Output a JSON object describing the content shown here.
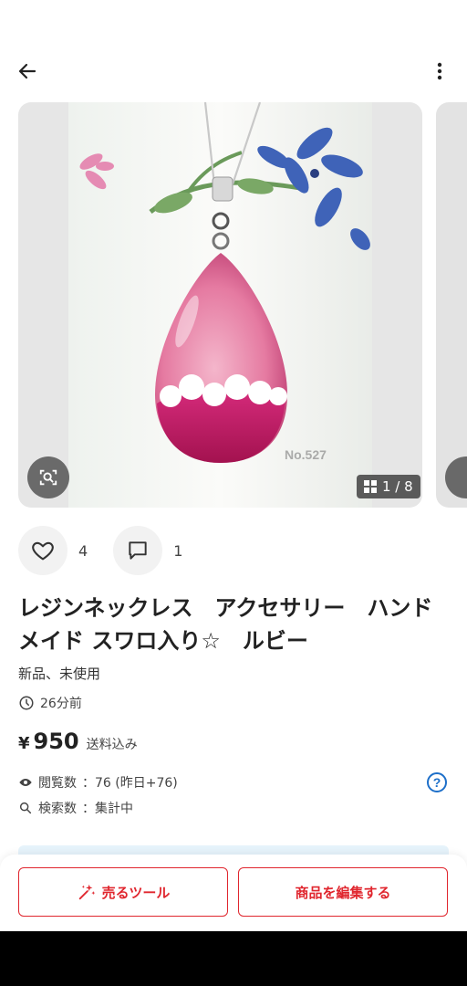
{
  "header": {
    "back_icon": "arrow-left-icon",
    "menu_icon": "more-vertical-icon"
  },
  "gallery": {
    "counter": "1 / 8",
    "watermark": "No.527",
    "lens_icon": "image-search-icon",
    "grid_icon": "grid-icon"
  },
  "engagement": {
    "likes": "4",
    "comments": "1",
    "like_icon": "heart-outline-icon",
    "comment_icon": "comment-icon"
  },
  "item": {
    "title": "レジンネックレス　アクセサリー　ハンドメイド スワロ入り☆　ルビー",
    "condition": "新品、未使用",
    "posted_ago": "26分前",
    "price_symbol": "¥",
    "price": "950",
    "shipping": "送料込み"
  },
  "stats": {
    "views_label": "閲覧数",
    "views_value": "：76 (昨日+76)",
    "search_label": "検索数",
    "search_value": "：集計中",
    "help": "?"
  },
  "footer": {
    "sell_tools": "売るツール",
    "edit_item": "商品を編集する"
  },
  "colors": {
    "accent": "#e0262e",
    "link": "#1d6fc9",
    "banner": "#e6f3fb"
  }
}
